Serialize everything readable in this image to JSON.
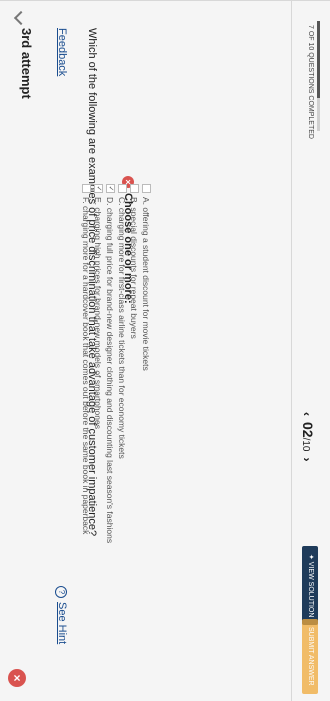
{
  "header": {
    "title": "3rd attempt",
    "close_icon": "×"
  },
  "feedback": {
    "label": "Feedback"
  },
  "hint": {
    "icon": "?",
    "label": "See Hint"
  },
  "question": {
    "text": "Which of the following are examples of price discrimination that take advantage of customer impatience?"
  },
  "choose": {
    "icon": "×",
    "label": "Choose one or more:"
  },
  "options": [
    {
      "mark": "",
      "text": "A. offering a student discount for movie tickets"
    },
    {
      "mark": "",
      "text": "B. special discounts for repeat buyers"
    },
    {
      "mark": "",
      "text": "C. charging more for first-class airline tickets than for economy tickets"
    },
    {
      "mark": "✓",
      "text": "D. charging full price for brand-new designer clothing and discounting last season's fashions"
    },
    {
      "mark": "✓",
      "text": "E. charging high prices for brand-new models of smartphones"
    },
    {
      "mark": "",
      "text": "F. charging more for a hardcover book that comes out before the same book in paperback"
    }
  ],
  "footer": {
    "progress_label": "7 OF 10 QUESTIONS COMPLETED",
    "progress_fraction": 0.7,
    "prev_arrow": "‹",
    "page_current": "02",
    "page_total": "/10",
    "next_arrow": "›",
    "view_solution": "✦ VIEW SOLUTION",
    "submit": "SUBMIT ANSWER"
  }
}
